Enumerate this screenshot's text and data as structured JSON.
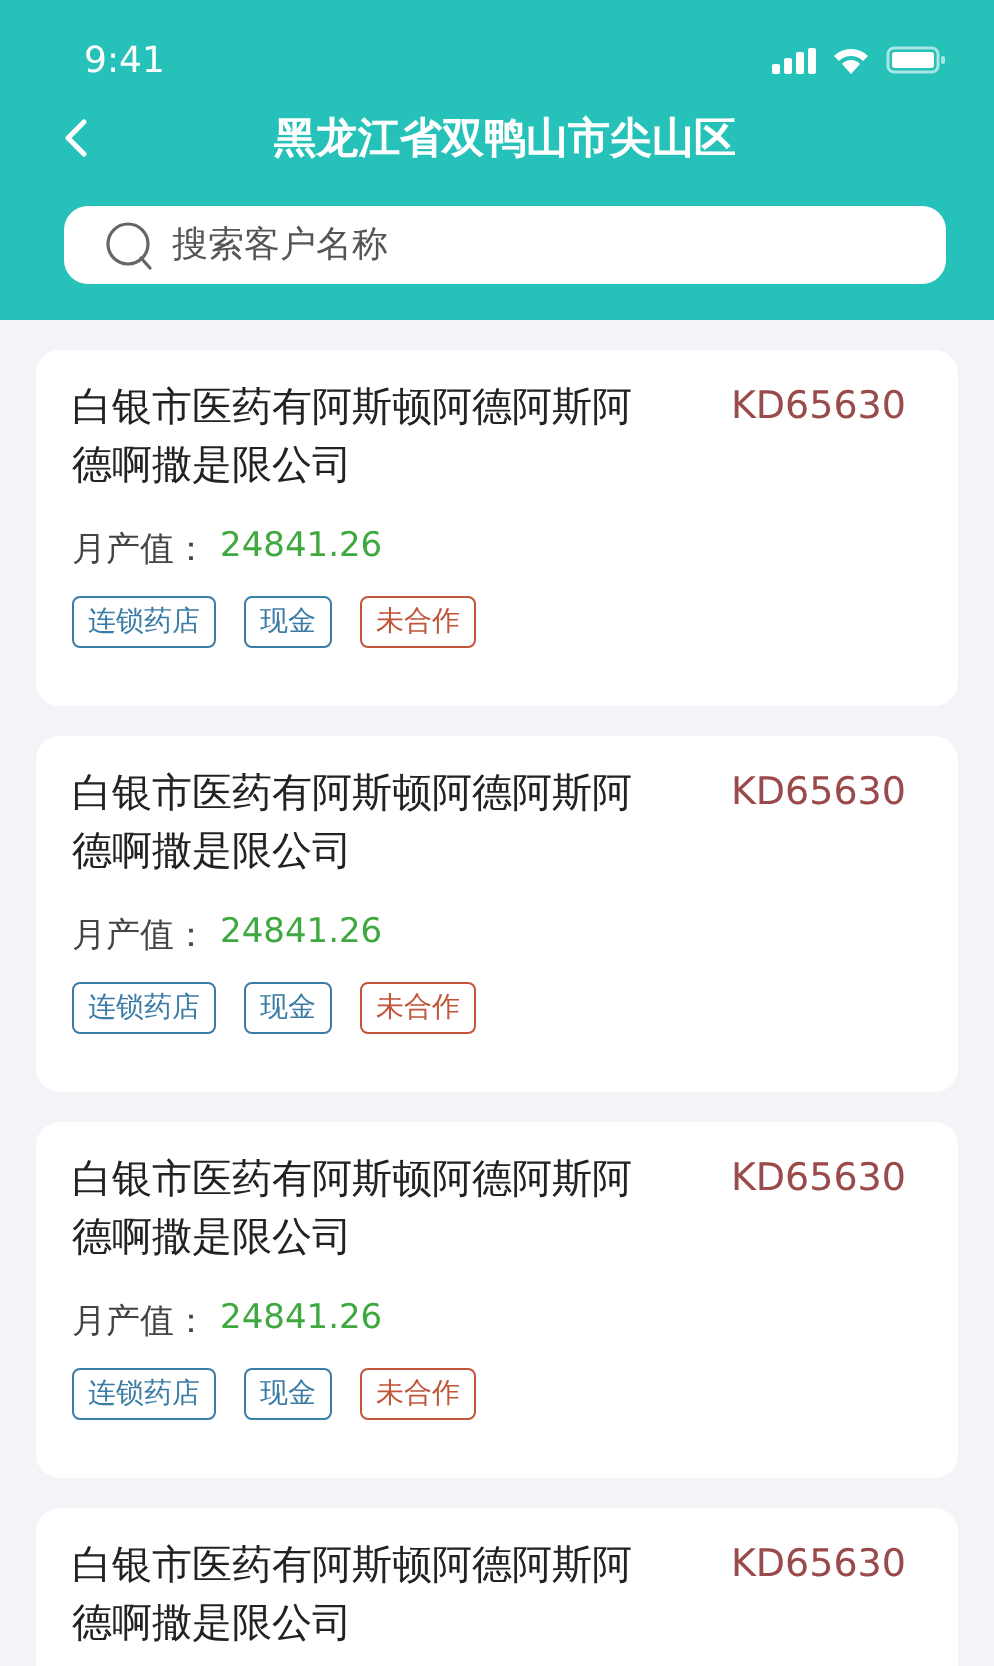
{
  "status_bar": {
    "time": "9:41"
  },
  "header": {
    "title": "黑龙江省双鸭山市尖山区"
  },
  "search": {
    "placeholder": "搜索客户名称"
  },
  "customers": [
    {
      "name": "白银市医药有阿斯顿阿德阿斯阿德啊撒是限公司",
      "code": "KD65630",
      "value_label": "月产值：",
      "value": "24841.26",
      "tags": [
        {
          "label": "连锁药店",
          "color": "#3a7ca5"
        },
        {
          "label": "现金",
          "color": "#3a7ca5"
        },
        {
          "label": "未合作",
          "color": "#c0553a"
        }
      ]
    },
    {
      "name": "白银市医药有阿斯顿阿德阿斯阿德啊撒是限公司",
      "code": "KD65630",
      "value_label": "月产值：",
      "value": "24841.26",
      "tags": [
        {
          "label": "连锁药店",
          "color": "#3a7ca5"
        },
        {
          "label": "现金",
          "color": "#3a7ca5"
        },
        {
          "label": "未合作",
          "color": "#c0553a"
        }
      ]
    },
    {
      "name": "白银市医药有阿斯顿阿德阿斯阿德啊撒是限公司",
      "code": "KD65630",
      "value_label": "月产值：",
      "value": "24841.26",
      "tags": [
        {
          "label": "连锁药店",
          "color": "#3a7ca5"
        },
        {
          "label": "现金",
          "color": "#3a7ca5"
        },
        {
          "label": "未合作",
          "color": "#c0553a"
        }
      ]
    },
    {
      "name": "白银市医药有阿斯顿阿德阿斯阿德啊撒是限公司",
      "code": "KD65630"
    }
  ]
}
